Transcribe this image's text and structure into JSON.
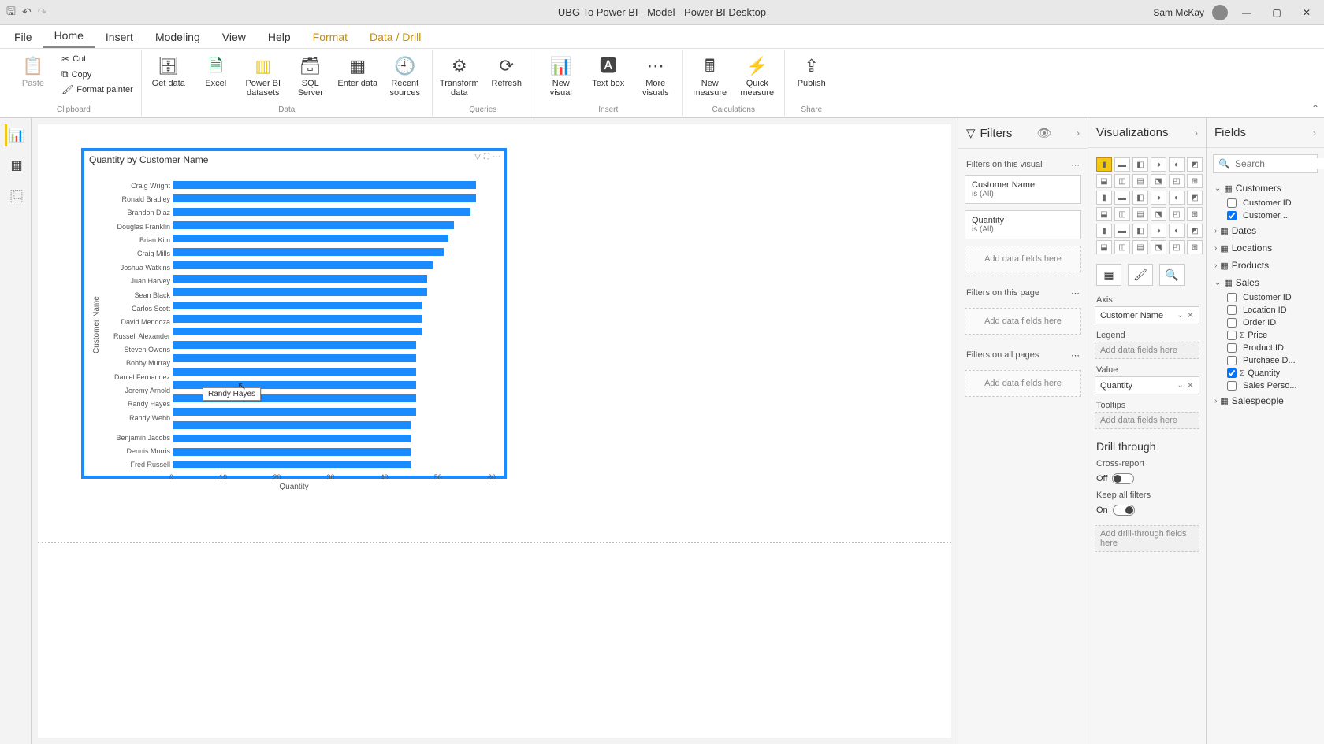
{
  "titlebar": {
    "title": "UBG To Power BI - Model - Power BI Desktop",
    "user": "Sam McKay"
  },
  "tabs": [
    "File",
    "Home",
    "Insert",
    "Modeling",
    "View",
    "Help",
    "Format",
    "Data / Drill"
  ],
  "ribbon": {
    "clipboard": {
      "cut": "Cut",
      "copy": "Copy",
      "fp": "Format painter",
      "paste": "Paste",
      "label": "Clipboard"
    },
    "data": {
      "get": "Get data",
      "excel": "Excel",
      "pbi": "Power BI datasets",
      "sql": "SQL Server",
      "enter": "Enter data",
      "recent": "Recent sources",
      "label": "Data"
    },
    "queries": {
      "transform": "Transform data",
      "refresh": "Refresh",
      "label": "Queries"
    },
    "insert": {
      "newv": "New visual",
      "text": "Text box",
      "more": "More visuals",
      "label": "Insert"
    },
    "calc": {
      "newm": "New measure",
      "quick": "Quick measure",
      "label": "Calculations"
    },
    "share": {
      "publish": "Publish",
      "label": "Share"
    }
  },
  "filters": {
    "title": "Filters",
    "sec_visual": "Filters on this visual",
    "card_cust": "Customer Name",
    "card_cust_sub": "is (All)",
    "card_qty": "Quantity",
    "card_qty_sub": "is (All)",
    "add": "Add data fields here",
    "sec_page": "Filters on this page",
    "sec_all": "Filters on all pages"
  },
  "viz": {
    "title": "Visualizations",
    "axis": "Axis",
    "legend": "Legend",
    "value": "Value",
    "tooltips": "Tooltips",
    "axis_field": "Customer Name",
    "value_field": "Quantity",
    "empty": "Add data fields here",
    "drill": "Drill through",
    "cross": "Cross-report",
    "off": "Off",
    "keep": "Keep all filters",
    "on": "On",
    "drill_empty": "Add drill-through fields here"
  },
  "fields": {
    "title": "Fields",
    "search": "Search",
    "tables": {
      "Customers": [
        "Customer ID",
        "Customer ..."
      ],
      "Dates": [],
      "Locations": [],
      "Products": [],
      "Sales": [
        "Customer ID",
        "Location ID",
        "Order ID",
        "Price",
        "Product ID",
        "Purchase D...",
        "Quantity",
        "Sales Perso..."
      ],
      "Salespeople": []
    },
    "checked": [
      "Customer ...",
      "Quantity"
    ],
    "sigma": [
      "Price",
      "Quantity"
    ]
  },
  "chart_data": {
    "type": "bar",
    "title": "Quantity by Customer Name",
    "xlabel": "Quantity",
    "ylabel": "Customer Name",
    "xlim": [
      0,
      60
    ],
    "xticks": [
      0,
      10,
      20,
      30,
      40,
      50,
      60
    ],
    "categories": [
      "Craig Wright",
      "Ronald Bradley",
      "Brandon Diaz",
      "Douglas Franklin",
      "Brian Kim",
      "Craig Mills",
      "Joshua Watkins",
      "Juan Harvey",
      "Sean Black",
      "Carlos Scott",
      "David Mendoza",
      "Russell Alexander",
      "Steven Owens",
      "Bobby Murray",
      "Daniel Fernandez",
      "Jeremy Arnold",
      "Randy Hayes",
      "Randy Webb",
      "",
      "Benjamin Jacobs",
      "Dennis Morris",
      "Fred Russell"
    ],
    "values": [
      56,
      56,
      55,
      52,
      51,
      50,
      48,
      47,
      47,
      46,
      46,
      46,
      45,
      45,
      45,
      45,
      45,
      45,
      44,
      44,
      44,
      44
    ],
    "tooltip": "Randy Hayes"
  }
}
